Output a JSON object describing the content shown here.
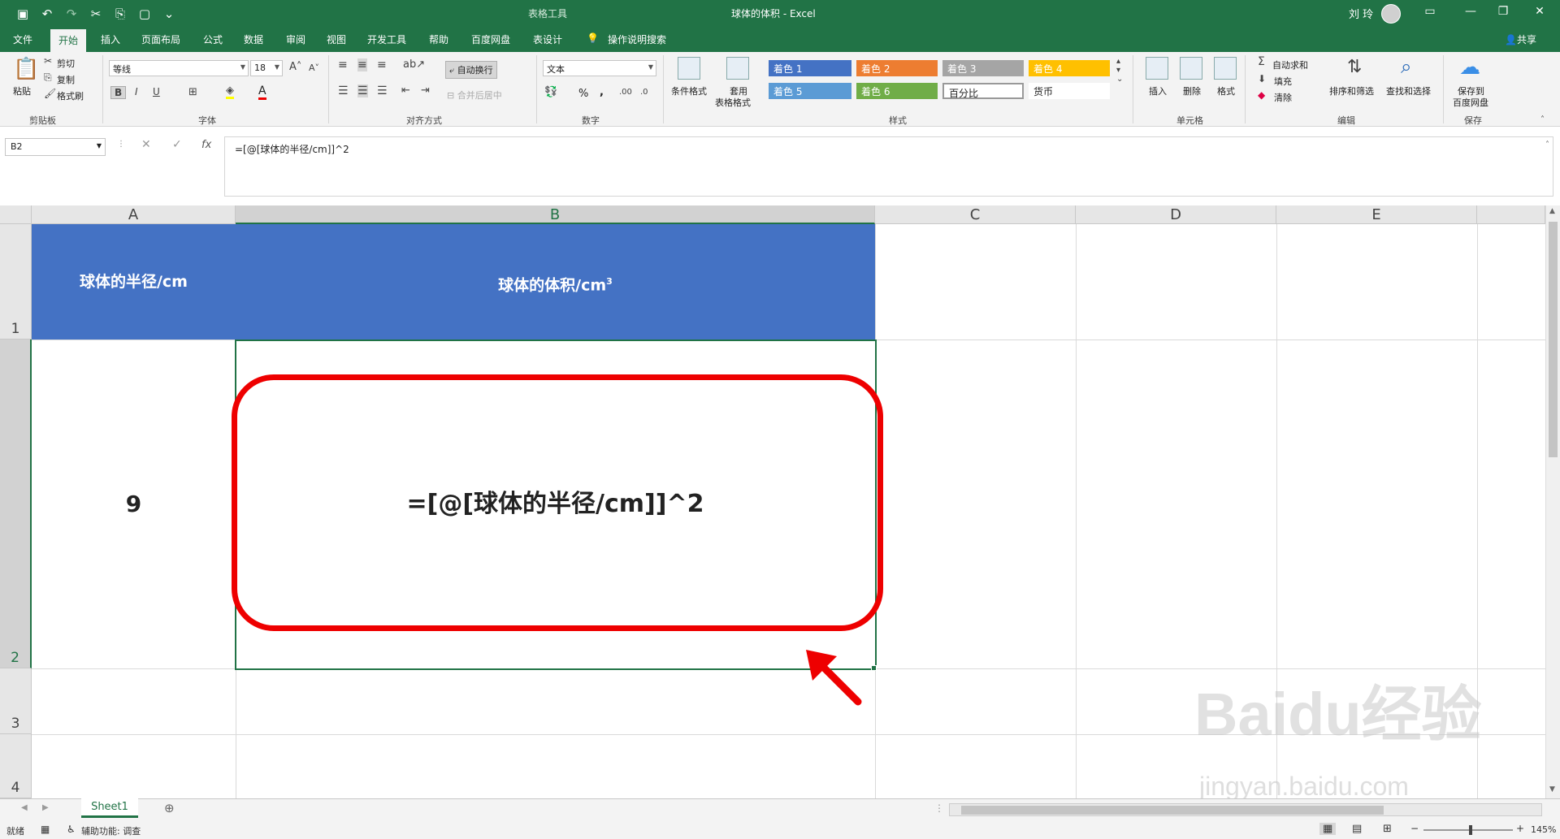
{
  "titlebar": {
    "context_tab": "表格工具",
    "doc_title": "球体的体积  -  Excel",
    "user": "刘 玲",
    "qat_icons": [
      "save-icon",
      "undo-icon",
      "redo-icon",
      "cut-icon",
      "save-as-icon",
      "new-icon",
      "customize-icon"
    ]
  },
  "tabs": [
    "文件",
    "开始",
    "插入",
    "页面布局",
    "公式",
    "数据",
    "审阅",
    "视图",
    "开发工具",
    "帮助",
    "百度网盘",
    "表设计"
  ],
  "active_tab": "开始",
  "tell_me": "操作说明搜索",
  "share": "共享",
  "ribbon": {
    "clipboard": {
      "paste": "粘贴",
      "cut": "剪切",
      "copy": "复制",
      "format_painter": "格式刷",
      "label": "剪贴板"
    },
    "font": {
      "name": "等线",
      "size": "18",
      "label": "字体"
    },
    "alignment": {
      "wrap_text": "自动换行",
      "merge": "合并后居中",
      "label": "对齐方式"
    },
    "number": {
      "format": "文本",
      "percent": "%",
      "comma": ",",
      "label": "数字"
    },
    "styles": {
      "conditional": "条件格式",
      "table_format_1": "套用",
      "table_format_2": "表格格式",
      "cells": [
        {
          "label": "着色 1",
          "bg": "#4472c4",
          "fg": "#ffffff"
        },
        {
          "label": "着色 2",
          "bg": "#ed7d31",
          "fg": "#ffffff"
        },
        {
          "label": "着色 3",
          "bg": "#a5a5a5",
          "fg": "#ffffff"
        },
        {
          "label": "着色 4",
          "bg": "#ffc000",
          "fg": "#ffffff"
        },
        {
          "label": "着色 5",
          "bg": "#5b9bd5",
          "fg": "#ffffff"
        },
        {
          "label": "着色 6",
          "bg": "#70ad47",
          "fg": "#ffffff"
        },
        {
          "label": "百分比",
          "bg": "#ffffff",
          "fg": "#222222"
        },
        {
          "label": "货币",
          "bg": "#ffffff",
          "fg": "#222222"
        }
      ],
      "label": "样式"
    },
    "cells_group": {
      "insert": "插入",
      "delete": "删除",
      "format": "格式",
      "label": "单元格"
    },
    "editing": {
      "autosum": "自动求和",
      "fill": "填充",
      "clear": "清除",
      "sort": "排序和筛选",
      "find": "查找和选择",
      "label": "编辑"
    },
    "save": {
      "line1": "保存到",
      "line2": "百度网盘",
      "label": "保存"
    }
  },
  "formula_bar": {
    "name_box": "B2",
    "formula": "=[@[球体的半径/cm]]^2"
  },
  "columns": [
    "A",
    "B",
    "C",
    "D",
    "E"
  ],
  "rows": [
    "1",
    "2",
    "3",
    "4"
  ],
  "cells": {
    "A1": "球体的半径/cm",
    "B1": "球体的体积/cm",
    "B1_sup": "3",
    "A2": "9",
    "B2": "=[@[球体的半径/cm]]^2"
  },
  "sheet_tab": "Sheet1",
  "status": {
    "ready": "就绪",
    "accessibility": "辅助功能: 调查",
    "zoom": "145%"
  },
  "watermark": {
    "brand": "Baidu经验",
    "url": "jingyan.baidu.com"
  },
  "colors": {
    "excel_green": "#217346",
    "header_blue": "#4472c4",
    "highlight_red": "#ee0000"
  }
}
